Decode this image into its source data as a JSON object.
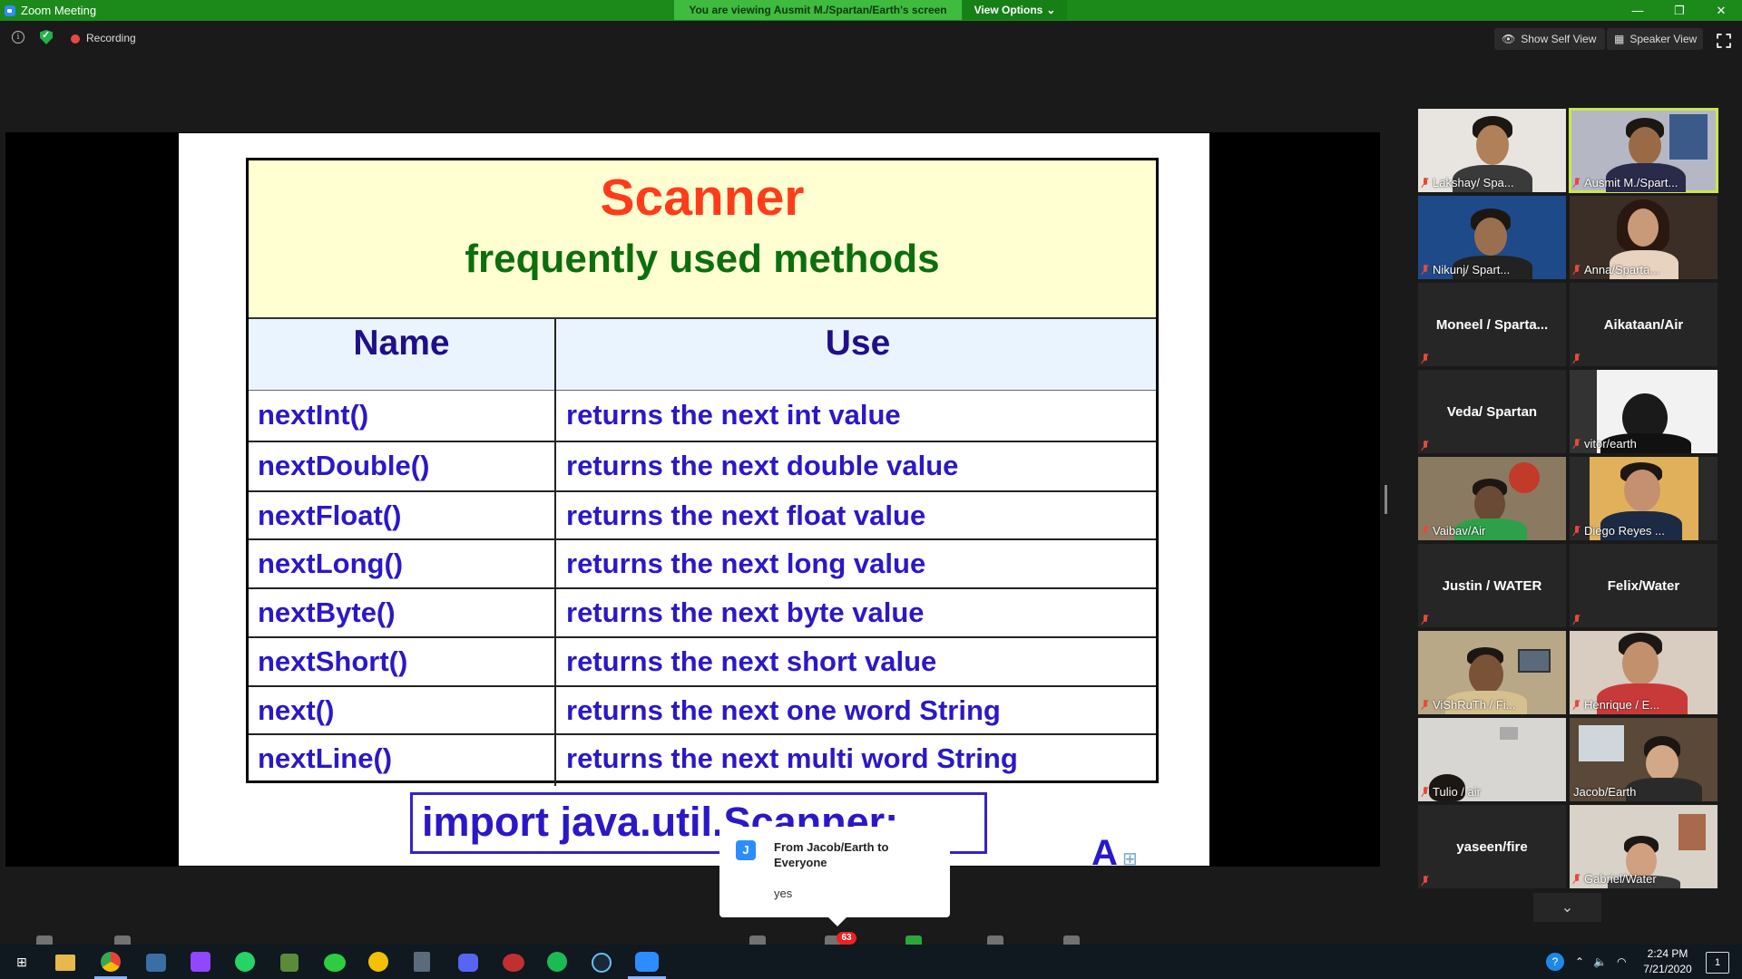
{
  "window": {
    "title": "Zoom Meeting",
    "banner": "You are viewing Ausmit M./Spartan/Earth's screen",
    "view_options": "View Options",
    "view_options_arrow": "⌄",
    "minimize": "—",
    "maximize": "❐",
    "close": "✕"
  },
  "toolbar": {
    "info_glyph": "i",
    "recording": "Recording",
    "show_self_view": "Show Self View",
    "speaker_view": "Speaker View"
  },
  "slide": {
    "title": "Scanner",
    "subtitle": "frequently used methods",
    "headers": {
      "name": "Name",
      "use": "Use"
    },
    "rows": [
      {
        "name": "nextInt()",
        "use": "returns the next int value"
      },
      {
        "name": "nextDouble()",
        "use": "returns the next double value"
      },
      {
        "name": "nextFloat()",
        "use": "returns the next float value"
      },
      {
        "name": "nextLong()",
        "use": "returns the next long value"
      },
      {
        "name": "nextByte()",
        "use": "returns the next byte value"
      },
      {
        "name": "nextShort()",
        "use": "returns the next short value"
      },
      {
        "name": "next()",
        "use": "returns the next one word String"
      },
      {
        "name": "nextLine()",
        "use": "returns the next multi word String"
      }
    ],
    "import_line": "import  java.util.Scanner;",
    "logo_letter": "A"
  },
  "chat": {
    "avatar_letter": "J",
    "from": "From Jacob/Earth to Everyone",
    "message": "yes"
  },
  "controls": {
    "chat_badge": "63"
  },
  "participants": [
    {
      "name": "Lakshay/ Spa...",
      "video": true,
      "active": false
    },
    {
      "name": "Ausmit M./Spart...",
      "video": true,
      "active": true
    },
    {
      "name": "Nikunj/ Spart...",
      "video": true,
      "active": false
    },
    {
      "name": "Anna/Sparta...",
      "video": true,
      "active": false
    },
    {
      "name": "Moneel  / Sparta...",
      "video": false,
      "active": false
    },
    {
      "name": "Aikataan/Air",
      "video": false,
      "active": false
    },
    {
      "name": "Veda/ Spartan",
      "video": false,
      "active": false
    },
    {
      "name": "vitor/earth",
      "video": true,
      "active": false
    },
    {
      "name": "Vaibav/Air",
      "video": true,
      "active": false
    },
    {
      "name": "Diego Reyes ...",
      "video": true,
      "active": false
    },
    {
      "name": "Justin / WATER",
      "video": false,
      "active": false
    },
    {
      "name": "Felix/Water",
      "video": false,
      "active": false
    },
    {
      "name": "ViShRuTh / Fi...",
      "video": true,
      "active": false
    },
    {
      "name": "Henrique / E...",
      "video": true,
      "active": false
    },
    {
      "name": "Tulio / air",
      "video": true,
      "active": false
    },
    {
      "name": "Jacob/Earth",
      "video": true,
      "active": false
    },
    {
      "name": "yaseen/fire",
      "video": false,
      "active": false
    },
    {
      "name": "Gabriel/Water",
      "video": true,
      "active": false
    }
  ],
  "gallery": {
    "more_arrow": "⌄"
  },
  "taskbar": {
    "apps": [
      "start-icon",
      "file-explorer-icon",
      "chrome-icon",
      "store-icon",
      "twitch-icon",
      "whatsapp-icon",
      "minecraft-icon",
      "cloud-app-icon",
      "norton-icon",
      "calculator-icon",
      "discord-icon",
      "steam-link-icon",
      "spotify-icon",
      "steam-icon",
      "zoom-icon"
    ],
    "time": "2:24 PM",
    "date": "7/21/2020",
    "notification_count": "1"
  },
  "colors": {
    "titlebar": "#1b8a1b",
    "banner": "#3fbb3f",
    "slide_title": "#ff3c1a",
    "slide_subtitle": "#0c6e0c",
    "slide_text": "#2a18c8",
    "active_speaker": "#c9e84a"
  }
}
